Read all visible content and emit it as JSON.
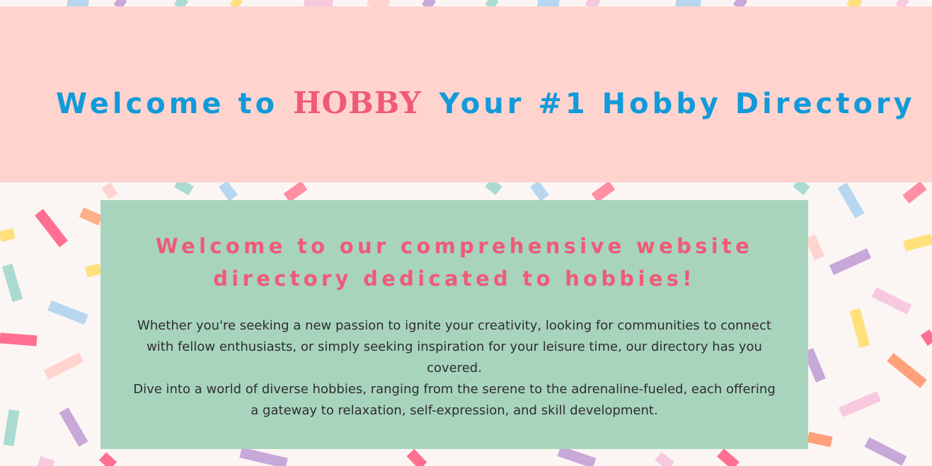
{
  "hero": {
    "prefix": "Welcome to",
    "brand": "HOBBY",
    "suffix": "Your #1 Hobby Directory"
  },
  "intro": {
    "heading_line1": "Welcome to our comprehensive website",
    "heading_line2": "directory dedicated to hobbies!",
    "paragraph1": "Whether you're seeking a new passion to ignite your creativity, looking for communities to connect with fellow enthusiasts, or simply seeking inspiration for your leisure time, our directory has you covered.",
    "paragraph2": "Dive into a world of diverse hobbies, ranging from the serene to the adrenaline-fueled, each offering a gateway to relaxation, self-expression, and skill development."
  },
  "theme": {
    "hero_bg": "#ffd4cf",
    "card_bg": "#a8d4bd",
    "title_blue": "#129ad9",
    "accent_pink": "#f05a78",
    "page_bg": "#fbf6f3"
  }
}
